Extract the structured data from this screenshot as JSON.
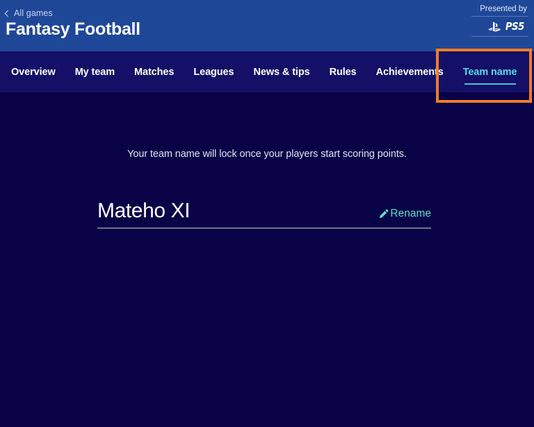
{
  "header": {
    "back_label": "All games",
    "back_icon": "chevron-left-icon",
    "title": "Fantasy Football",
    "presented_label": "Presented by",
    "sponsor_logo": "ps5-logo",
    "sponsor_name": "PS5",
    "bg_color": "#1f4798"
  },
  "nav": {
    "bg_color": "#141067",
    "active_color": "#55d8e8",
    "items": [
      {
        "label": "Overview",
        "active": false
      },
      {
        "label": "My team",
        "active": false
      },
      {
        "label": "Matches",
        "active": false
      },
      {
        "label": "Leagues",
        "active": false
      },
      {
        "label": "News & tips",
        "active": false
      },
      {
        "label": "Rules",
        "active": false
      },
      {
        "label": "Achievements",
        "active": false
      },
      {
        "label": "Team name",
        "active": true
      }
    ]
  },
  "highlight": {
    "target": "Team name",
    "color": "#f07d28"
  },
  "main": {
    "bg_color": "#0a0246",
    "lock_note": "Your team name will lock once your players start scoring points.",
    "team_name": "Mateho XI",
    "rename_label": "Rename",
    "rename_icon": "pencil-icon",
    "rename_color": "#55e0cf"
  }
}
